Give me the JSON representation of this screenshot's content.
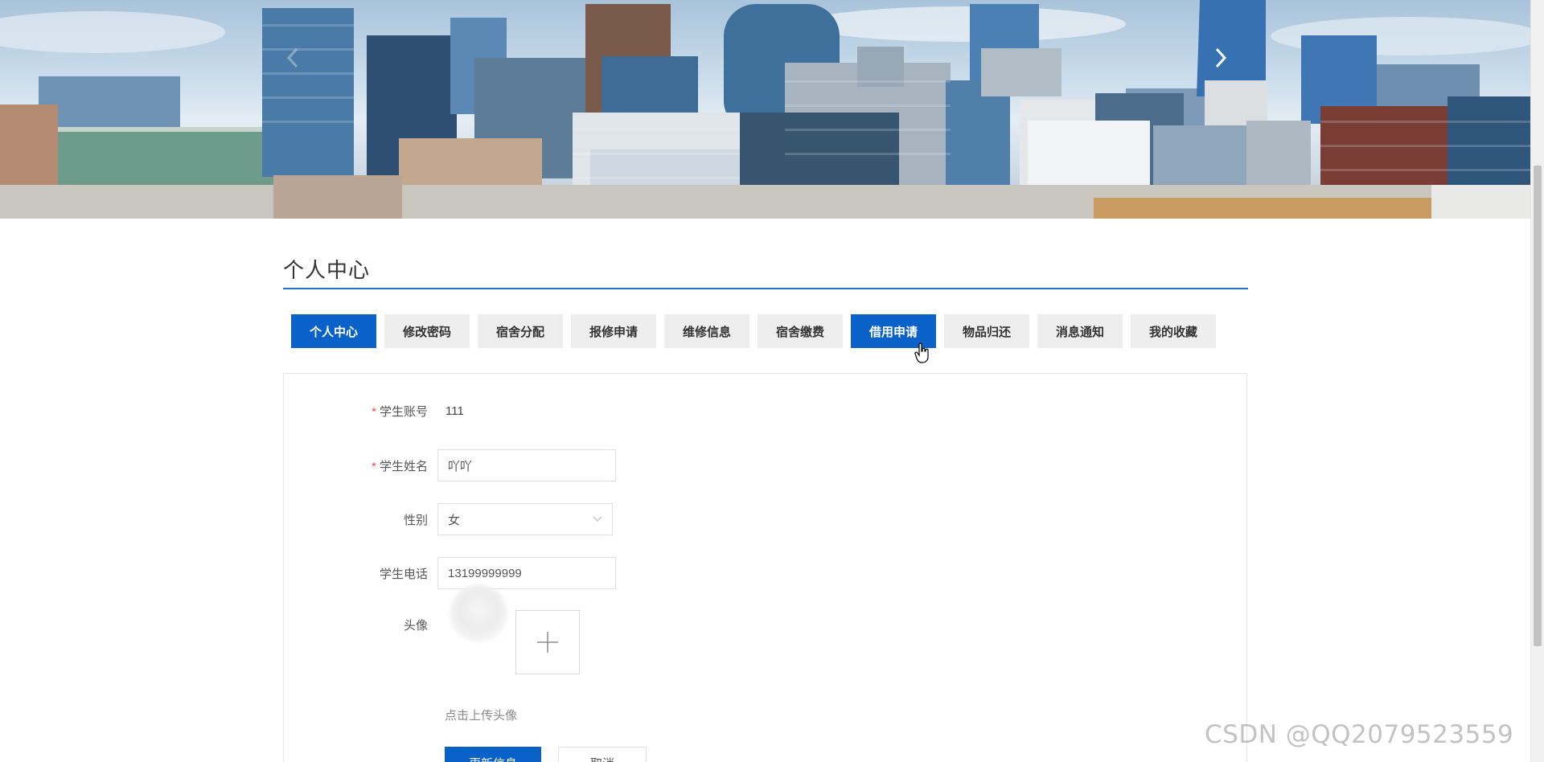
{
  "header": {
    "title": "个人中心"
  },
  "banner": {
    "prev_icon": "chevron-left-icon",
    "next_icon": "chevron-right-icon"
  },
  "tabs": [
    {
      "label": "个人中心",
      "state": "active"
    },
    {
      "label": "修改密码",
      "state": ""
    },
    {
      "label": "宿舍分配",
      "state": ""
    },
    {
      "label": "报修申请",
      "state": ""
    },
    {
      "label": "维修信息",
      "state": ""
    },
    {
      "label": "宿舍缴费",
      "state": ""
    },
    {
      "label": "借用申请",
      "state": "hover"
    },
    {
      "label": "物品归还",
      "state": ""
    },
    {
      "label": "消息通知",
      "state": ""
    },
    {
      "label": "我的收藏",
      "state": ""
    }
  ],
  "form": {
    "account": {
      "label": "学生账号",
      "value": "111",
      "required": "*"
    },
    "name": {
      "label": "学生姓名",
      "value": "吖吖",
      "required": "*"
    },
    "gender": {
      "label": "性别",
      "value": "女"
    },
    "phone": {
      "label": "学生电话",
      "value": "13199999999"
    },
    "avatar": {
      "label": "头像",
      "hint": "点击上传头像",
      "upload_icon": "plus-icon"
    },
    "submit_label": "更新信息",
    "cancel_label": "取消"
  },
  "watermark": "CSDN @QQ2079523559",
  "colors": {
    "primary": "#0a62c9",
    "title_line": "#1f6fcc",
    "required": "#e04f4f",
    "tab_bg": "#eeeeee"
  }
}
